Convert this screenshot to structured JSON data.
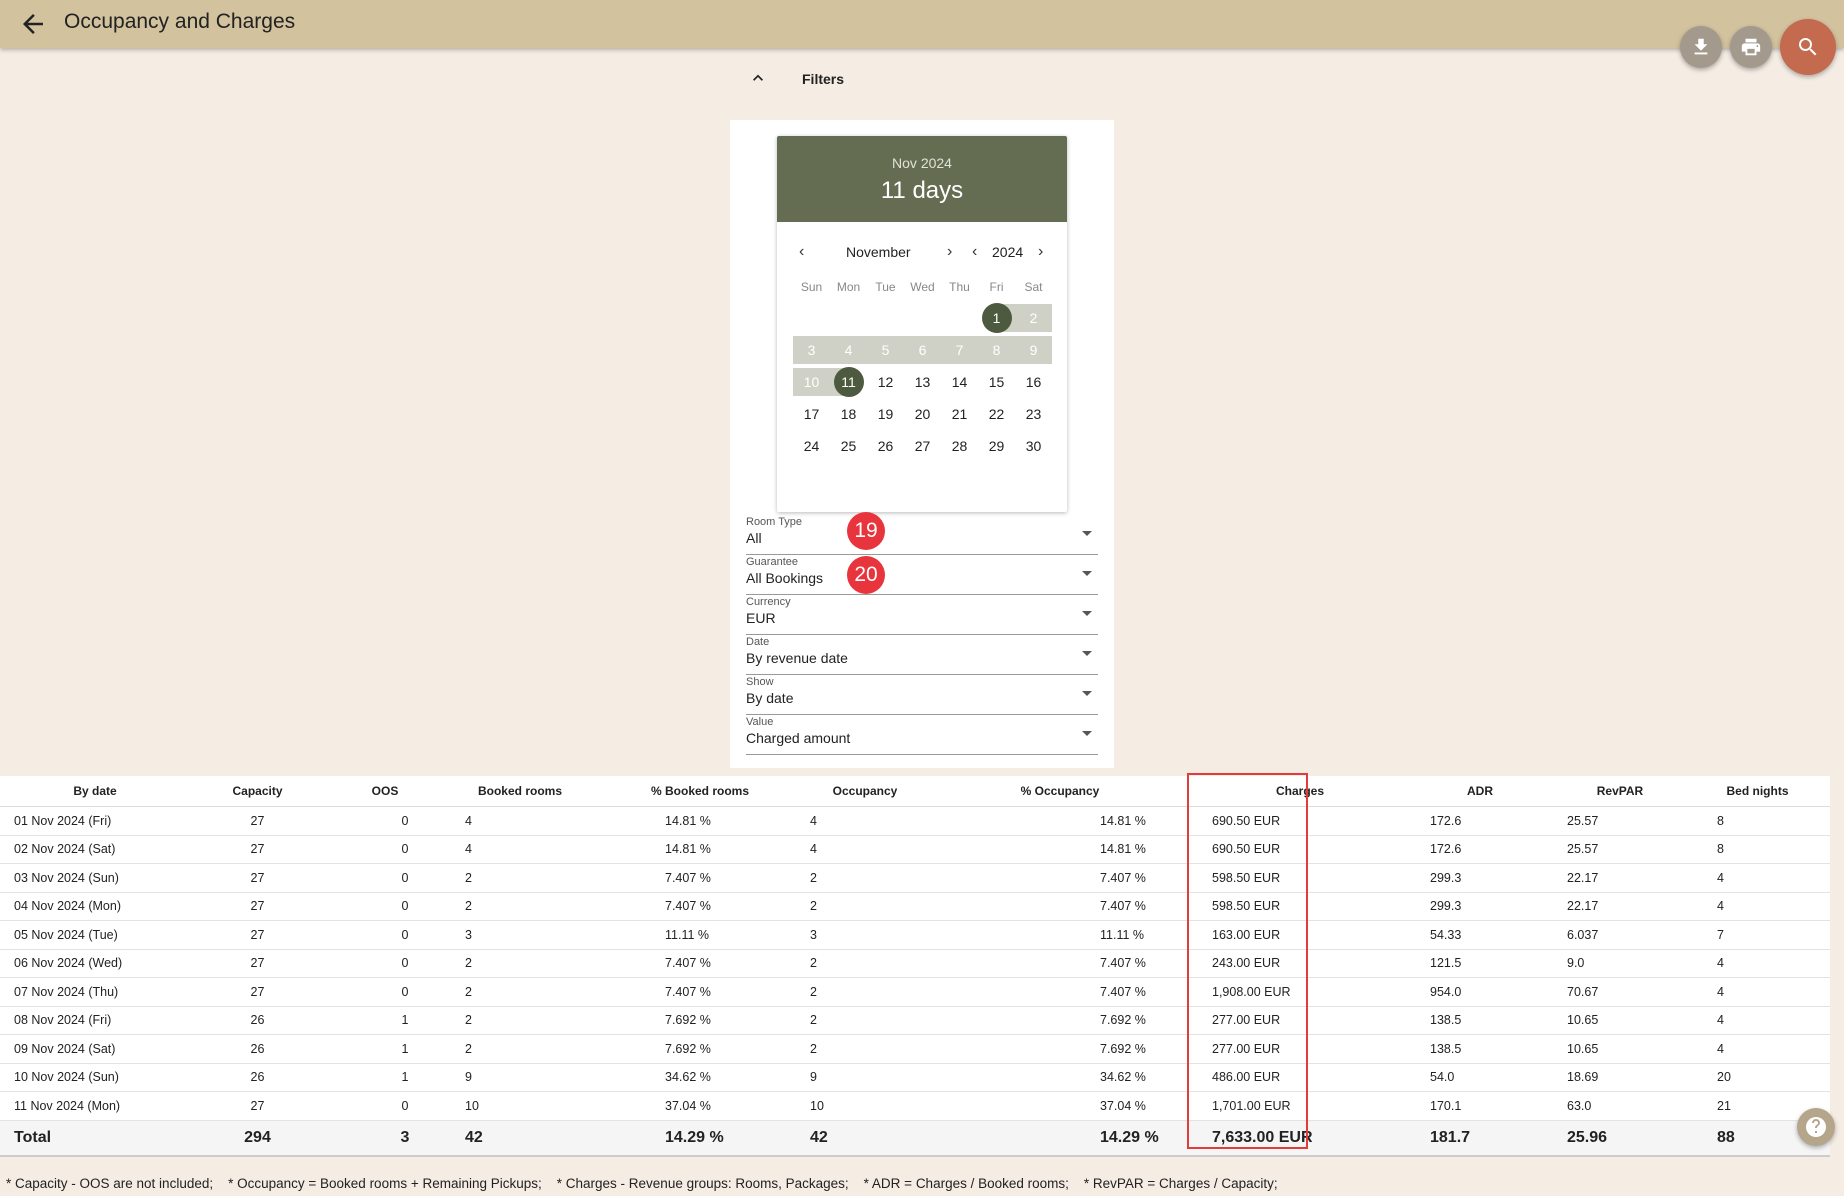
{
  "header": {
    "title": "Occupancy and Charges",
    "back_icon": "arrow-back-icon",
    "download_icon": "download-icon",
    "print_icon": "print-icon",
    "search_icon": "search-icon"
  },
  "filters": {
    "label": "Filters",
    "toggle_icon": "chevron-up-icon"
  },
  "calendar": {
    "header_month": "Nov 2024",
    "header_days": "11 days",
    "month_label": "November",
    "year_label": "2024",
    "weekdays": [
      "Sun",
      "Mon",
      "Tue",
      "Wed",
      "Thu",
      "Fri",
      "Sat"
    ],
    "weeks": [
      [
        "",
        "",
        "",
        "",
        "",
        "1",
        "2"
      ],
      [
        "3",
        "4",
        "5",
        "6",
        "7",
        "8",
        "9"
      ],
      [
        "10",
        "11",
        "12",
        "13",
        "14",
        "15",
        "16"
      ],
      [
        "17",
        "18",
        "19",
        "20",
        "21",
        "22",
        "23"
      ],
      [
        "24",
        "25",
        "26",
        "27",
        "28",
        "29",
        "30"
      ]
    ],
    "range_start": "1",
    "range_end": "11",
    "accent_color": "#646d51"
  },
  "fields": [
    {
      "label": "Room Type",
      "value": "All"
    },
    {
      "label": "Guarantee",
      "value": "All Bookings"
    },
    {
      "label": "Currency",
      "value": "EUR"
    },
    {
      "label": "Date",
      "value": "By revenue date"
    },
    {
      "label": "Show",
      "value": "By date"
    },
    {
      "label": "Value",
      "value": "Charged amount"
    }
  ],
  "badges": [
    "19",
    "20"
  ],
  "table": {
    "headers": [
      "By date",
      "Capacity",
      "OOS",
      "Booked rooms",
      "% Booked rooms",
      "Occupancy",
      "% Occupancy",
      "Charges",
      "ADR",
      "RevPAR",
      "Bed nights"
    ],
    "rows": [
      [
        "01 Nov 2024 (Fri)",
        "27",
        "0",
        "4",
        "14.81 %",
        "4",
        "14.81 %",
        "690.50 EUR",
        "172.6",
        "25.57",
        "8"
      ],
      [
        "02 Nov 2024 (Sat)",
        "27",
        "0",
        "4",
        "14.81 %",
        "4",
        "14.81 %",
        "690.50 EUR",
        "172.6",
        "25.57",
        "8"
      ],
      [
        "03 Nov 2024 (Sun)",
        "27",
        "0",
        "2",
        "7.407 %",
        "2",
        "7.407 %",
        "598.50 EUR",
        "299.3",
        "22.17",
        "4"
      ],
      [
        "04 Nov 2024 (Mon)",
        "27",
        "0",
        "2",
        "7.407 %",
        "2",
        "7.407 %",
        "598.50 EUR",
        "299.3",
        "22.17",
        "4"
      ],
      [
        "05 Nov 2024 (Tue)",
        "27",
        "0",
        "3",
        "11.11 %",
        "3",
        "11.11 %",
        "163.00 EUR",
        "54.33",
        "6.037",
        "7"
      ],
      [
        "06 Nov 2024 (Wed)",
        "27",
        "0",
        "2",
        "7.407 %",
        "2",
        "7.407 %",
        "243.00 EUR",
        "121.5",
        "9.0",
        "4"
      ],
      [
        "07 Nov 2024 (Thu)",
        "27",
        "0",
        "2",
        "7.407 %",
        "2",
        "7.407 %",
        "1,908.00 EUR",
        "954.0",
        "70.67",
        "4"
      ],
      [
        "08 Nov 2024 (Fri)",
        "26",
        "1",
        "2",
        "7.692 %",
        "2",
        "7.692 %",
        "277.00 EUR",
        "138.5",
        "10.65",
        "4"
      ],
      [
        "09 Nov 2024 (Sat)",
        "26",
        "1",
        "2",
        "7.692 %",
        "2",
        "7.692 %",
        "277.00 EUR",
        "138.5",
        "10.65",
        "4"
      ],
      [
        "10 Nov 2024 (Sun)",
        "26",
        "1",
        "9",
        "34.62 %",
        "9",
        "34.62 %",
        "486.00 EUR",
        "54.0",
        "18.69",
        "20"
      ],
      [
        "11 Nov 2024 (Mon)",
        "27",
        "0",
        "10",
        "37.04 %",
        "10",
        "37.04 %",
        "1,701.00 EUR",
        "170.1",
        "63.0",
        "21"
      ]
    ],
    "total": [
      "Total",
      "294",
      "3",
      "42",
      "14.29 %",
      "42",
      "14.29 %",
      "7,633.00 EUR",
      "181.7",
      "25.96",
      "88"
    ]
  },
  "footnote": "* Capacity - OOS are not included;    * Occupancy = Booked rooms + Remaining Pickups;    * Charges - Revenue groups: Rooms, Packages;    * ADR = Charges / Booked rooms;    * RevPAR = Charges / Capacity;",
  "help_icon": "help-icon"
}
